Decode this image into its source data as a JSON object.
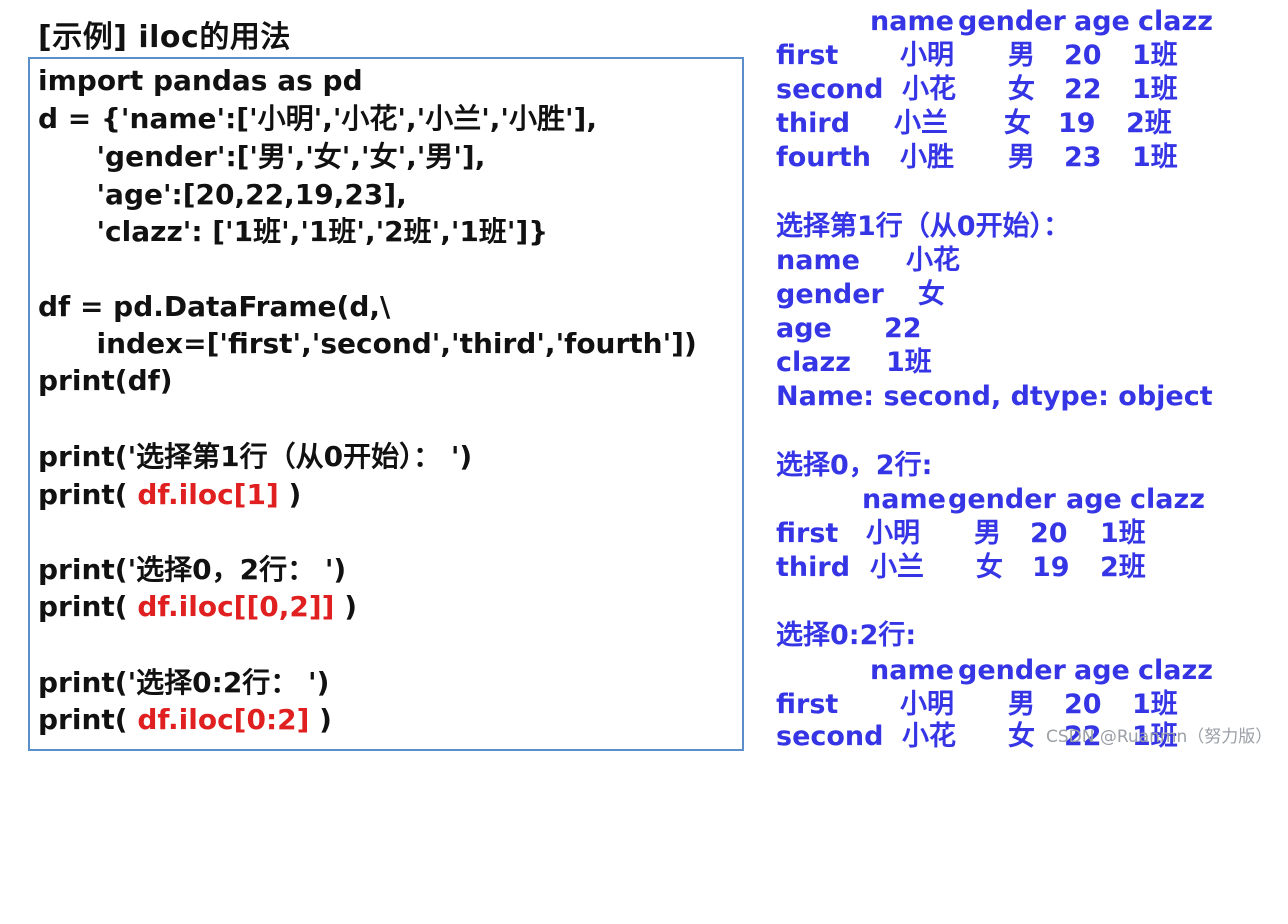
{
  "title": "[示例]  iloc的用法",
  "code": {
    "l1": "import pandas as pd",
    "l2": "d = {'name':['小明','小花','小兰','小胜'],",
    "l3": "      'gender':['男','女','女','男'],",
    "l4": "      'age':[20,22,19,23],",
    "l5": "      'clazz': ['1班','1班','2班','1班']}",
    "l6": "df = pd.DataFrame(d,\\",
    "l7": "      index=['first','second','third','fourth'])",
    "l8": "print(df)",
    "l9": "print('选择第1行（从0开始）： ')",
    "l10_pre": "print( ",
    "l10_red": "df.iloc[1]",
    "l10_post": " )",
    "l11": "print('选择0，2行： ')",
    "l12_pre": "print( ",
    "l12_red": "df.iloc[[0,2]]",
    "l12_post": " )",
    "l13": "print('选择0:2行： ')",
    "l14_pre": "print( ",
    "l14_red": "df.iloc[0:2]",
    "l14_post": " )"
  },
  "output": {
    "header1": {
      "name": "name",
      "gender": "gender",
      "age": "age",
      "clazz": "clazz"
    },
    "rows1": [
      {
        "idx": "first",
        "name": "小明",
        "gender": "男",
        "age": "20",
        "clazz": "1班"
      },
      {
        "idx": "second",
        "name": "小花",
        "gender": "女",
        "age": "22",
        "clazz": "1班"
      },
      {
        "idx": "third",
        "name": "小兰",
        "gender": "女",
        "age": "19",
        "clazz": "2班"
      },
      {
        "idx": "fourth",
        "name": "小胜",
        "gender": "男",
        "age": "23",
        "clazz": "1班"
      }
    ],
    "sec2_title": "选择第1行（从0开始）：",
    "series": [
      {
        "k": "name",
        "v": "小花"
      },
      {
        "k": "gender",
        "v": "女"
      },
      {
        "k": "age",
        "v": "22"
      },
      {
        "k": "clazz",
        "v": "1班"
      }
    ],
    "series_footer": "Name: second, dtype: object",
    "sec3_title": "选择0，2行:",
    "header3": {
      "name": "name",
      "gender": "gender",
      "age": "age",
      "clazz": "clazz"
    },
    "rows3": [
      {
        "idx": "first",
        "name": "小明",
        "gender": "男",
        "age": "20",
        "clazz": "1班"
      },
      {
        "idx": "third",
        "name": "小兰",
        "gender": "女",
        "age": "19",
        "clazz": "2班"
      }
    ],
    "sec4_title": "选择0:2行:",
    "header4": {
      "name": "name",
      "gender": "gender",
      "age": "age",
      "clazz": "clazz"
    },
    "rows4": [
      {
        "idx": "first",
        "name": "小明",
        "gender": "男",
        "age": "20",
        "clazz": "1班"
      },
      {
        "idx": "second",
        "name": "小花",
        "gender": "女",
        "age": "22",
        "clazz": "1班"
      }
    ]
  },
  "watermark": "CSDN @Ruanmn（努力版）"
}
